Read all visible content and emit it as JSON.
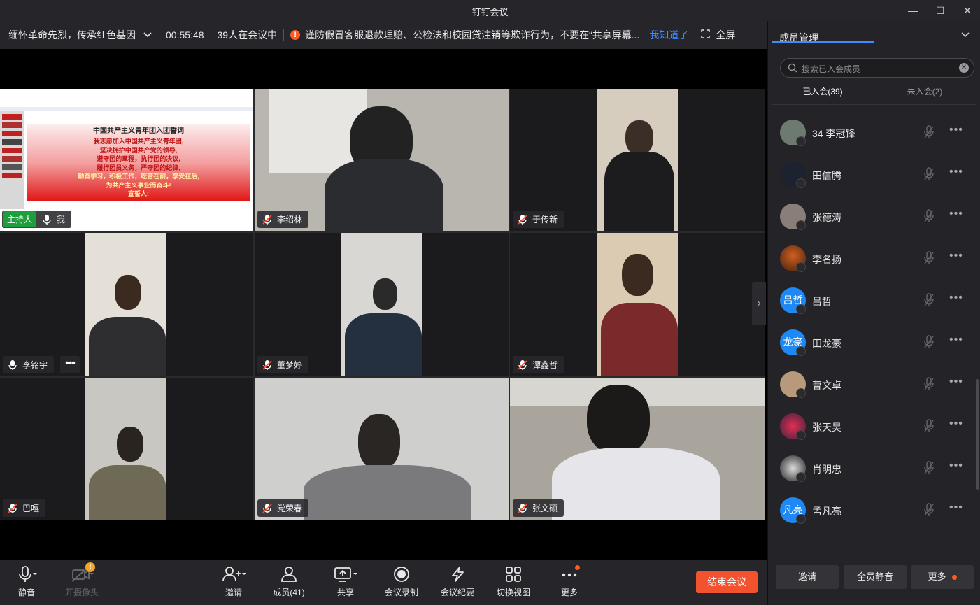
{
  "window": {
    "title": "钉钉会议"
  },
  "info": {
    "meeting_name": "缅怀革命先烈，传承红色基因",
    "duration": "00:55:48",
    "attendees": "39人在会议中",
    "notice": "谨防假冒客服退款理赔、公检法和校园贷注销等欺诈行为，不要在“共享屏幕...",
    "notice_ack": "我知道了",
    "fullscreen": "全屏"
  },
  "slide": {
    "title": "中国共产主义青年团入团誓词",
    "lines": [
      "我志愿加入中国共产主义青年团,",
      "坚决拥护中国共产党的领导,",
      "遵守团的章程，执行团的决议,",
      "履行团员义务，严守团的纪律,",
      "勤奋学习，积极工作，吃苦在前，享受在后,",
      "为共产主义事业而奋斗!",
      "宣誓人:"
    ]
  },
  "tiles": [
    {
      "name": "我",
      "host": "主持人"
    },
    {
      "name": "李绍林"
    },
    {
      "name": "于传新"
    },
    {
      "name": "李铭宇"
    },
    {
      "name": "董梦婷"
    },
    {
      "name": "谭鑫哲"
    },
    {
      "name": "巴嘎"
    },
    {
      "name": "党荣春"
    },
    {
      "name": "张文硕"
    }
  ],
  "toolbar": {
    "mute": "静音",
    "camera": "开摄像头",
    "invite": "邀请",
    "members": "成员(41)",
    "share": "共享",
    "record": "会议录制",
    "minutes": "会议纪要",
    "view": "切换视图",
    "more": "更多",
    "end": "结束会议"
  },
  "panel": {
    "title": "成员管理",
    "search_placeholder": "搜索已入会成员",
    "tab_joined": "已入会(39)",
    "tab_not_joined": "未入会(2)",
    "members": [
      {
        "name": "34   李冠锋",
        "avatar": "photo"
      },
      {
        "name": "田信腾",
        "avatar": "photo"
      },
      {
        "name": "张德涛",
        "avatar": "photo"
      },
      {
        "name": "李名扬",
        "avatar": "photo"
      },
      {
        "name": "吕哲",
        "avatar": "吕哲"
      },
      {
        "name": "田龙豪",
        "avatar": "龙豪"
      },
      {
        "name": "曹文卓",
        "avatar": "photo"
      },
      {
        "name": "张天昊",
        "avatar": "photo"
      },
      {
        "name": "肖明忠",
        "avatar": "photo"
      },
      {
        "name": "孟凡亮",
        "avatar": "凡亮"
      }
    ],
    "invite": "邀请",
    "mute_all": "全员静音",
    "more": "更多"
  },
  "colors": {
    "accent": "#3d8cff",
    "end": "#f2522e",
    "host": "#1e9e3c"
  }
}
